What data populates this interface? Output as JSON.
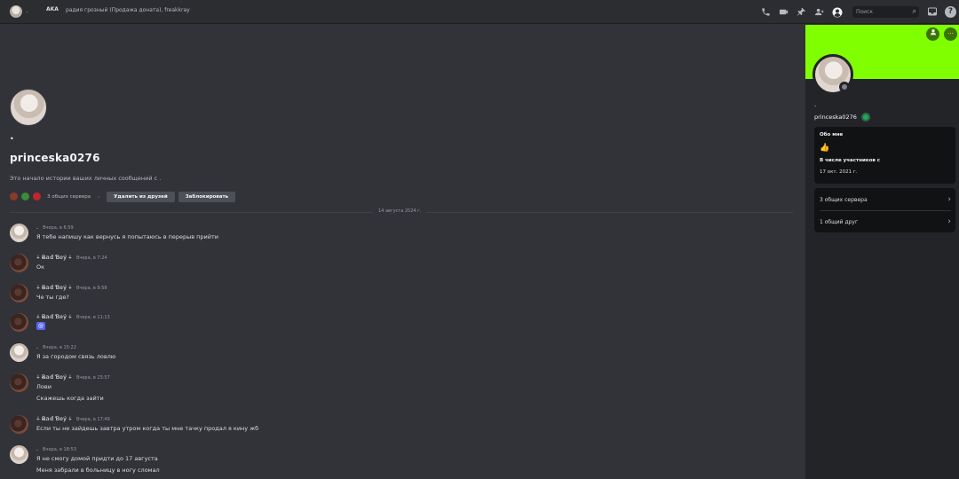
{
  "header": {
    "dot": ".",
    "aka_label": "AKA",
    "alias": "радия грозный (Продажа доната), freakkray",
    "search_placeholder": "Поиск",
    "icons": [
      "phone-icon",
      "video-icon",
      "pin-icon",
      "add-friend-icon",
      "profile-icon",
      "search-icon",
      "inbox-icon",
      "help-icon"
    ]
  },
  "intro": {
    "dot": "•",
    "username": "princeska0276",
    "description": "Это начало истории ваших личных сообщений с .",
    "mutual_servers": "3 общих сервера",
    "remove_friend": "Удалить из друзей",
    "block": "Заблокировать"
  },
  "date_divider": "14 августа 2024 г.",
  "messages": [
    {
      "author": ".",
      "time": "Вчера, в 6:59",
      "avatar": "girl",
      "lines": [
        "Я тебе напишу как вернусь я попытаюсь в перерыв прийти"
      ]
    },
    {
      "author": "⍭ Ƀ𝕒𝕕 Ɓ𝕠ý ⍭",
      "time": "Вчера, в 7:24",
      "avatar": "dark",
      "lines": [
        "Ок"
      ]
    },
    {
      "author": "⍭ Ƀ𝕒𝕕 Ɓ𝕠ý ⍭",
      "time": "Вчера, в 9:58",
      "avatar": "dark",
      "lines": [
        "Че ты где?"
      ]
    },
    {
      "author": "⍭ Ƀ𝕒𝕕 Ɓ𝕠ý ⍭",
      "time": "Вчера, в 11:13",
      "avatar": "dark",
      "lines": [
        "@"
      ]
    },
    {
      "author": ".",
      "time": "Вчера, в 15:22",
      "avatar": "girl",
      "lines": [
        "Я за городом связь ловлю"
      ]
    },
    {
      "author": "⍭ Ƀ𝕒𝕕 Ɓ𝕠ý ⍭",
      "time": "Вчера, в 15:57",
      "avatar": "dark",
      "lines": [
        "Лови",
        "Скажешь когда зайти"
      ]
    },
    {
      "author": "⍭ Ƀ𝕒𝕕 Ɓ𝕠ý ⍭",
      "time": "Вчера, в 17:49",
      "avatar": "dark",
      "lines": [
        "Если ты не зайдешь завтра утром когда ты мне тачку продал я кину жб"
      ]
    },
    {
      "author": ".",
      "time": "Вчера, в 18:53",
      "avatar": "girl",
      "lines": [
        "Я не смогу домой придти до 17 августа",
        "Меня забрали в больницу в ногу сломал"
      ]
    }
  ],
  "profile": {
    "banner_color": "#80ff00",
    "dot": ".",
    "username": "princeska0276",
    "about_label": "Обо мне",
    "about_emoji": "👍",
    "member_since_label": "В числе участников с",
    "member_since": "17 окт. 2021 г.",
    "mutual_servers": "3 общих сервера",
    "mutual_friends": "1 общий друг"
  },
  "colors": {
    "background": "#313338",
    "panel": "#232428",
    "accent": "#80ff00",
    "mention": "#5865f2"
  }
}
